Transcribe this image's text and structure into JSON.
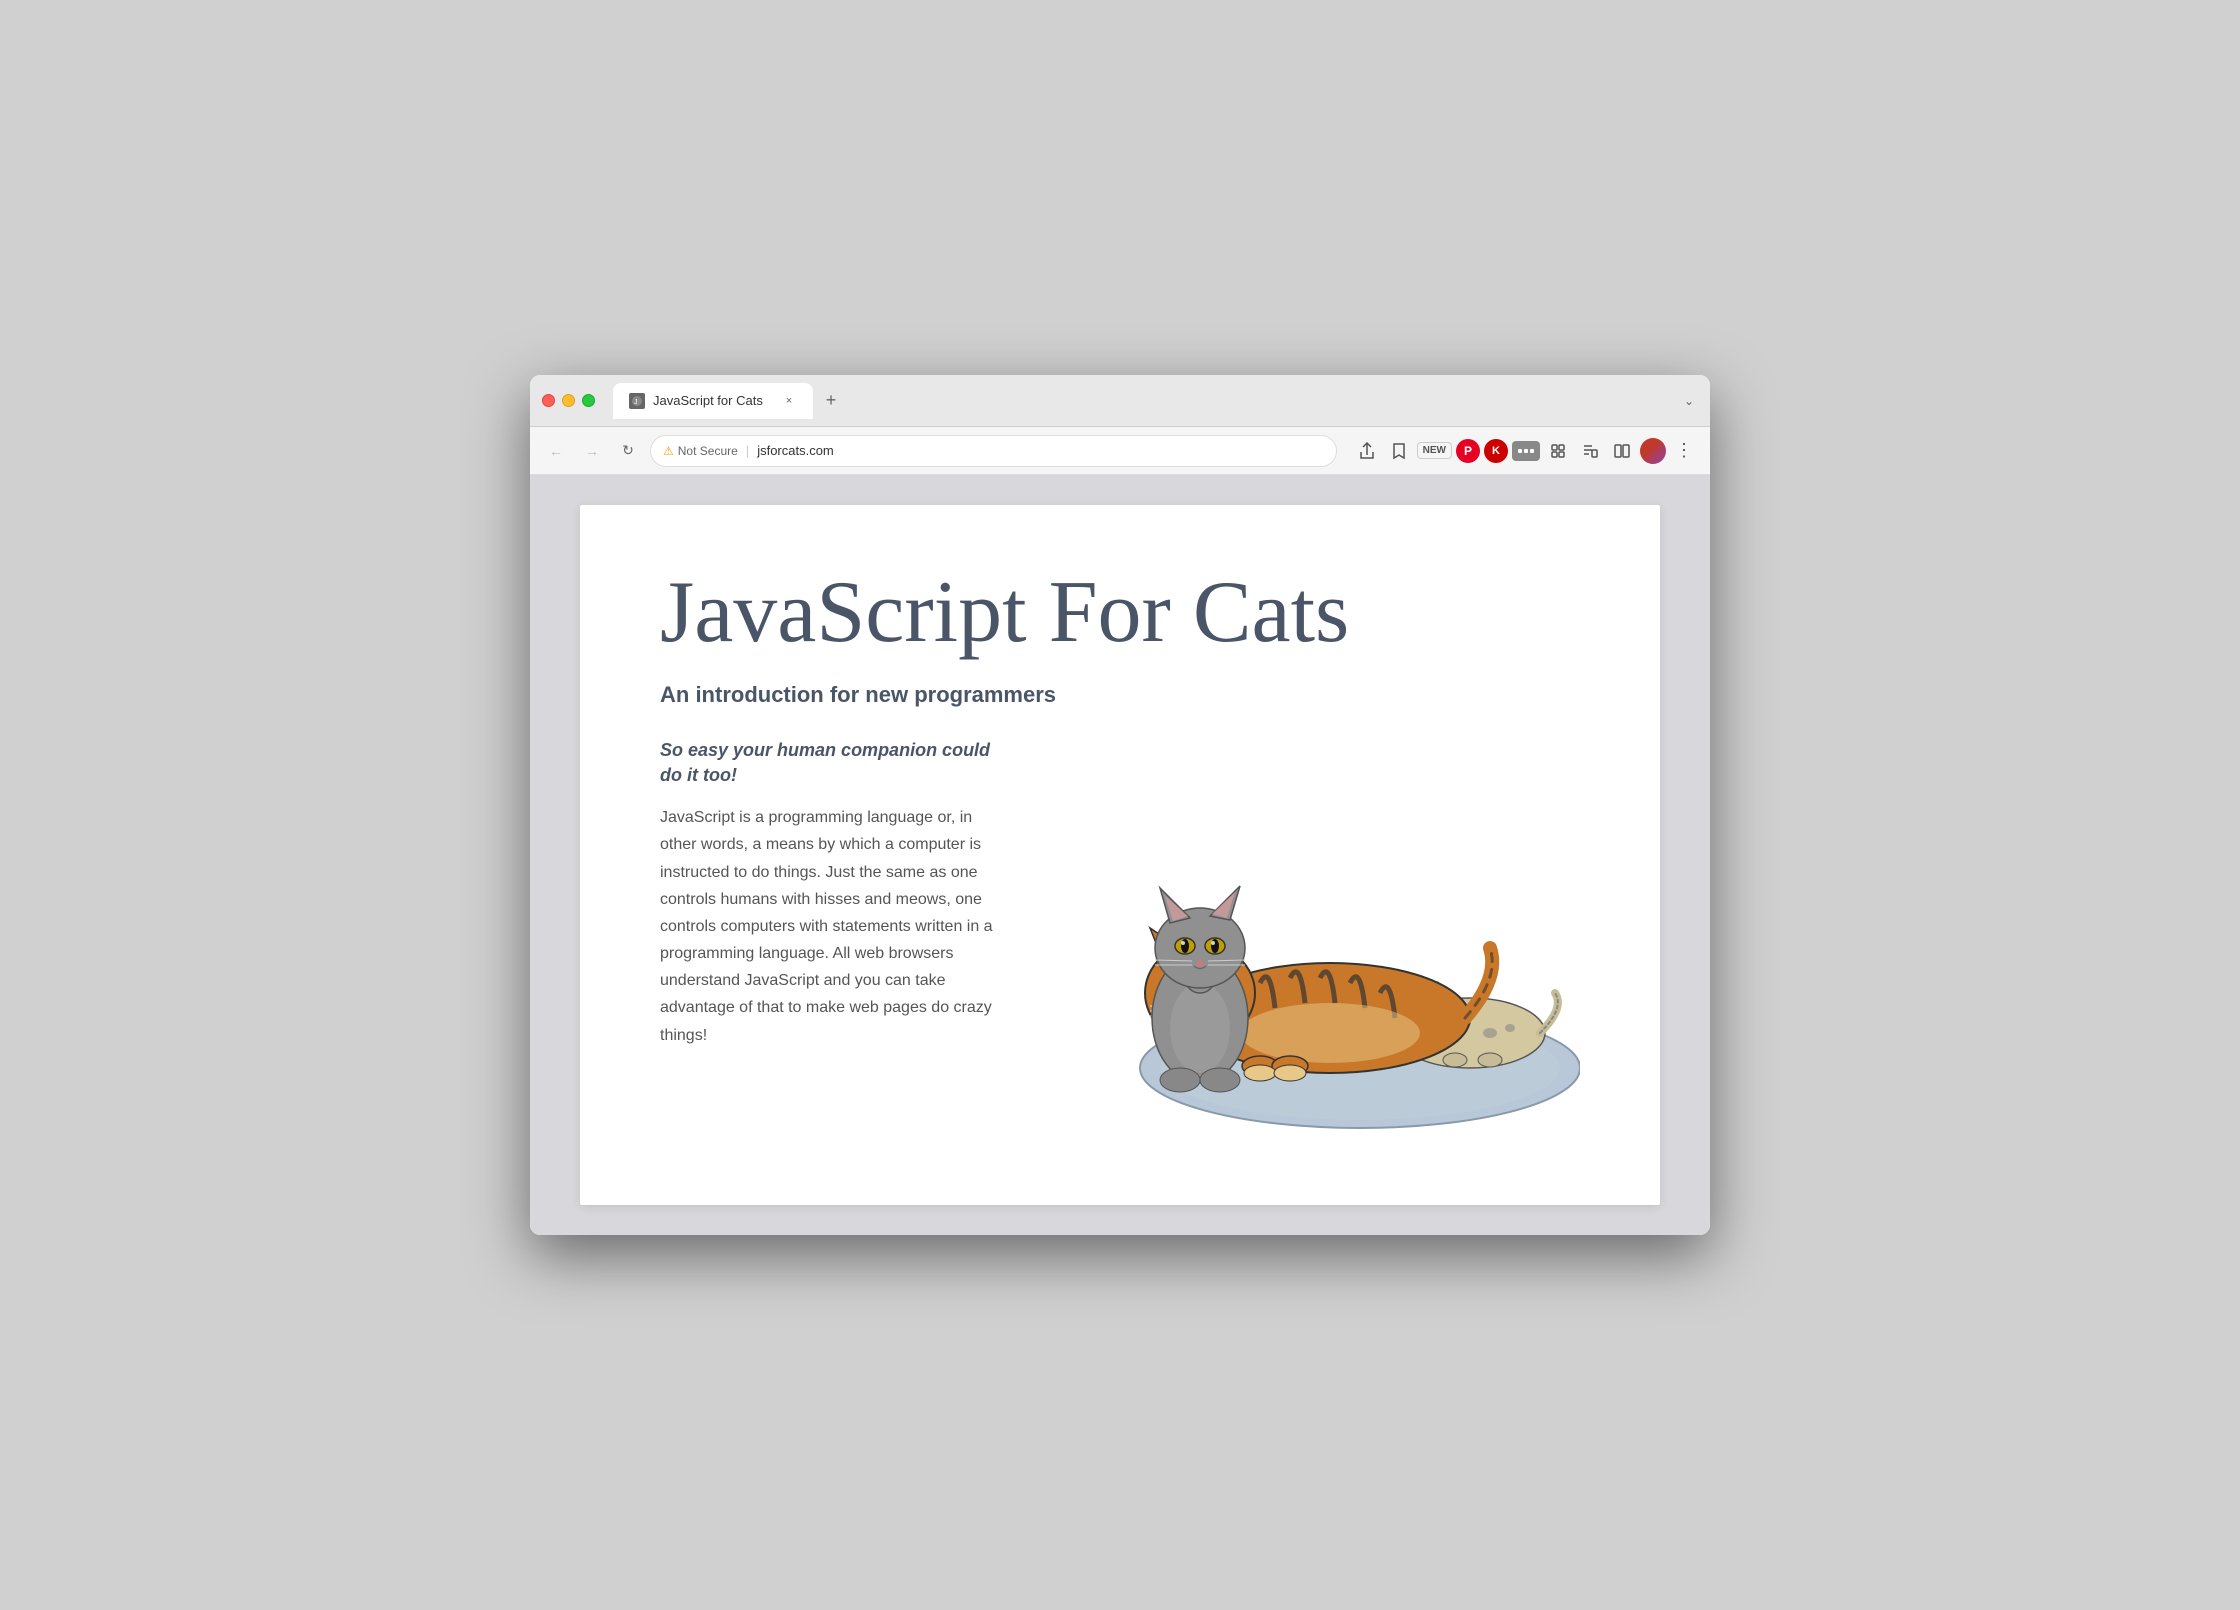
{
  "browser": {
    "tab": {
      "title": "JavaScript for Cats",
      "close_label": "×"
    },
    "new_tab_label": "+",
    "tab_list_label": "⌄",
    "nav": {
      "back_label": "←",
      "forward_label": "→",
      "reload_label": "↻",
      "security_text": "Not Secure",
      "divider": "|",
      "url": "jsforcats.com"
    },
    "toolbar": {
      "share_label": "⬆",
      "bookmark_label": "☆",
      "new_badge": "NEW",
      "ext_puzzle": "🧩",
      "queue_label": "☰",
      "split_label": "⧉",
      "menu_label": "⋮"
    }
  },
  "page": {
    "main_title": "JavaScript For Cats",
    "subtitle": "An introduction for new programmers",
    "tagline": "So easy your human\ncompanion could do it too!",
    "paragraph": "JavaScript is a programming language or, in other words, a means by which a computer is instructed to do things. Just the same as one controls humans with hisses and meows, one controls computers with statements written in a programming language. All web browsers understand JavaScript and you can take advantage of that to make web pages do crazy things!"
  }
}
